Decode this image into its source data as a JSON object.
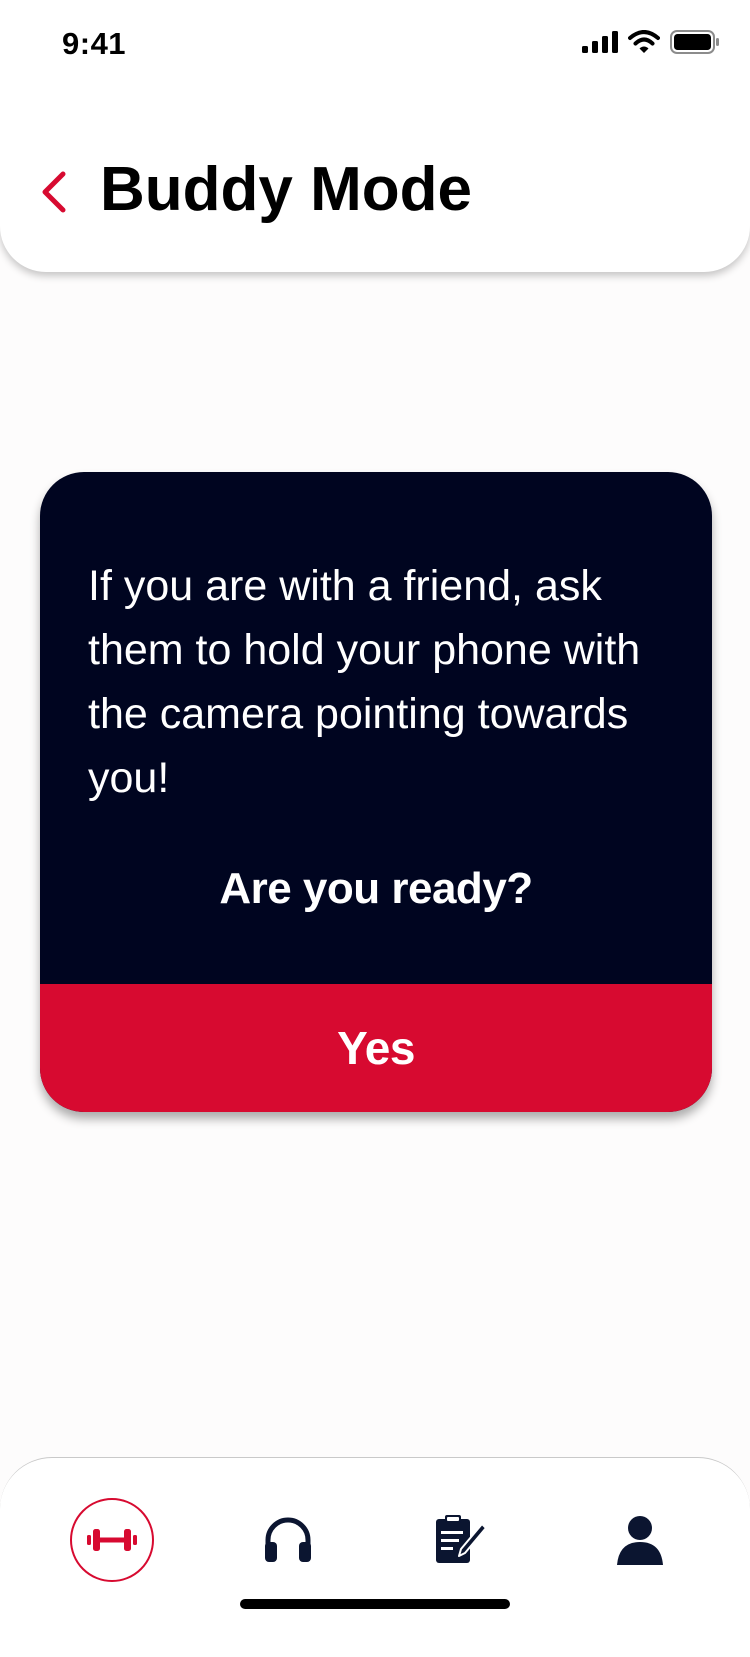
{
  "status_bar": {
    "time": "9:41",
    "signal_icon": "cellular-signal-icon",
    "wifi_icon": "wifi-icon",
    "battery_icon": "battery-icon"
  },
  "header": {
    "back_icon": "chevron-left-icon",
    "title": "Buddy Mode"
  },
  "prompt": {
    "message": "If you are with a friend, ask them to hold your phone with the camera pointing towards you!",
    "question": "Are you ready?",
    "confirm_label": "Yes"
  },
  "tab_bar": {
    "tabs": [
      {
        "icon": "dumbbell-icon",
        "active": true
      },
      {
        "icon": "headphones-icon",
        "active": false
      },
      {
        "icon": "clipboard-edit-icon",
        "active": false
      },
      {
        "icon": "user-profile-icon",
        "active": false
      }
    ]
  },
  "colors": {
    "accent": "#d70a30",
    "card_background": "#000520",
    "icon_dark": "#0b1530",
    "page_background": "#fdfcfc"
  }
}
